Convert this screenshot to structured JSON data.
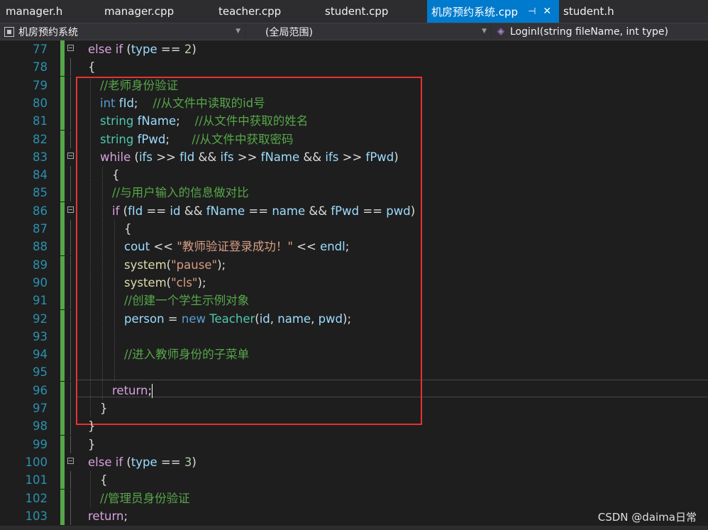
{
  "tabs": [
    {
      "label": "manager.h",
      "active": false
    },
    {
      "label": "manager.cpp",
      "active": false
    },
    {
      "label": "teacher.cpp",
      "active": false
    },
    {
      "label": "student.cpp",
      "active": false
    },
    {
      "label": "机房预约系统.cpp",
      "active": true,
      "pin": "⊣",
      "close": "✕"
    },
    {
      "label": "student.h",
      "active": false
    }
  ],
  "nav": {
    "project": "机房预约系统",
    "scope": "(全局范围)",
    "member": "LoginI(string fileName, int type)"
  },
  "lines": [
    {
      "n": "77",
      "tokens": [
        [
          "kw",
          "else if"
        ],
        [
          "pl",
          " ("
        ],
        [
          "var",
          "type"
        ],
        [
          "pl",
          " == "
        ],
        [
          "num",
          "2"
        ],
        [
          "pl",
          ")"
        ]
      ]
    },
    {
      "n": "78",
      "tokens": [
        [
          "pl",
          "{"
        ]
      ]
    },
    {
      "n": "79",
      "tokens": [
        [
          "com",
          "//老师身份验证"
        ]
      ]
    },
    {
      "n": "80",
      "tokens": [
        [
          "ty",
          "int"
        ],
        [
          "pl",
          " "
        ],
        [
          "var",
          "fId"
        ],
        [
          "pl",
          ";    "
        ],
        [
          "com",
          "//从文件中读取的id号"
        ]
      ]
    },
    {
      "n": "81",
      "tokens": [
        [
          "cls",
          "string"
        ],
        [
          "pl",
          " "
        ],
        [
          "var",
          "fName"
        ],
        [
          "pl",
          ";    "
        ],
        [
          "com",
          "//从文件中获取的姓名"
        ]
      ]
    },
    {
      "n": "82",
      "tokens": [
        [
          "cls",
          "string"
        ],
        [
          "pl",
          " "
        ],
        [
          "var",
          "fPwd"
        ],
        [
          "pl",
          ";      "
        ],
        [
          "com",
          "//从文件中获取密码"
        ]
      ]
    },
    {
      "n": "83",
      "tokens": [
        [
          "kw",
          "while"
        ],
        [
          "pl",
          " ("
        ],
        [
          "var",
          "ifs"
        ],
        [
          "pl",
          " >> "
        ],
        [
          "var",
          "fId"
        ],
        [
          "pl",
          " && "
        ],
        [
          "var",
          "ifs"
        ],
        [
          "pl",
          " >> "
        ],
        [
          "var",
          "fName"
        ],
        [
          "pl",
          " && "
        ],
        [
          "var",
          "ifs"
        ],
        [
          "pl",
          " >> "
        ],
        [
          "var",
          "fPwd"
        ],
        [
          "pl",
          ")"
        ]
      ]
    },
    {
      "n": "84",
      "tokens": [
        [
          "pl",
          "{"
        ]
      ]
    },
    {
      "n": "85",
      "tokens": [
        [
          "com",
          "//与用户输入的信息做对比"
        ]
      ]
    },
    {
      "n": "86",
      "tokens": [
        [
          "kw",
          "if"
        ],
        [
          "pl",
          " ("
        ],
        [
          "var",
          "fId"
        ],
        [
          "pl",
          " == "
        ],
        [
          "var",
          "id"
        ],
        [
          "pl",
          " && "
        ],
        [
          "var",
          "fName"
        ],
        [
          "pl",
          " == "
        ],
        [
          "var",
          "name"
        ],
        [
          "pl",
          " && "
        ],
        [
          "var",
          "fPwd"
        ],
        [
          "pl",
          " == "
        ],
        [
          "var",
          "pwd"
        ],
        [
          "pl",
          ")"
        ]
      ]
    },
    {
      "n": "87",
      "tokens": [
        [
          "pl",
          "{"
        ]
      ]
    },
    {
      "n": "88",
      "tokens": [
        [
          "var",
          "cout"
        ],
        [
          "pl",
          " << "
        ],
        [
          "str",
          "\"教师验证登录成功！\""
        ],
        [
          "pl",
          " << "
        ],
        [
          "var",
          "endl"
        ],
        [
          "pl",
          ";"
        ]
      ]
    },
    {
      "n": "89",
      "tokens": [
        [
          "fn",
          "system"
        ],
        [
          "pl",
          "("
        ],
        [
          "str",
          "\"pause\""
        ],
        [
          "pl",
          ");"
        ]
      ]
    },
    {
      "n": "90",
      "tokens": [
        [
          "fn",
          "system"
        ],
        [
          "pl",
          "("
        ],
        [
          "str",
          "\"cls\""
        ],
        [
          "pl",
          ");"
        ]
      ]
    },
    {
      "n": "91",
      "tokens": [
        [
          "com",
          "//创建一个学生示例对象"
        ]
      ]
    },
    {
      "n": "92",
      "tokens": [
        [
          "var",
          "person"
        ],
        [
          "pl",
          " = "
        ],
        [
          "ty",
          "new"
        ],
        [
          "pl",
          " "
        ],
        [
          "cls",
          "Teacher"
        ],
        [
          "pl",
          "("
        ],
        [
          "var",
          "id"
        ],
        [
          "pl",
          ", "
        ],
        [
          "var",
          "name"
        ],
        [
          "pl",
          ", "
        ],
        [
          "var",
          "pwd"
        ],
        [
          "pl",
          ");"
        ]
      ]
    },
    {
      "n": "93",
      "tokens": []
    },
    {
      "n": "94",
      "tokens": [
        [
          "com",
          "//进入教师身份的子菜单"
        ]
      ]
    },
    {
      "n": "95",
      "tokens": []
    },
    {
      "n": "96",
      "tokens": [
        [
          "kw",
          "return"
        ],
        [
          "pl",
          ";"
        ]
      ]
    },
    {
      "n": "97",
      "tokens": [
        [
          "pl",
          "}"
        ]
      ]
    },
    {
      "n": "98",
      "tokens": [
        [
          "pl",
          "}"
        ]
      ]
    },
    {
      "n": "99",
      "tokens": [
        [
          "pl",
          "}"
        ]
      ]
    },
    {
      "n": "100",
      "tokens": [
        [
          "kw",
          "else if"
        ],
        [
          "pl",
          " ("
        ],
        [
          "var",
          "type"
        ],
        [
          "pl",
          " == "
        ],
        [
          "num",
          "3"
        ],
        [
          "pl",
          ")"
        ]
      ]
    },
    {
      "n": "101",
      "tokens": [
        [
          "pl",
          "{"
        ]
      ]
    },
    {
      "n": "102",
      "tokens": [
        [
          "com",
          "//管理员身份验证"
        ]
      ]
    },
    {
      "n": "103",
      "tokens": [
        [
          "kw",
          "return"
        ],
        [
          "pl",
          ";"
        ]
      ]
    }
  ],
  "watermark": "CSDN @daima日常",
  "colors": {
    "accent": "#007acc",
    "highlight_box": "#e8322f",
    "line_number": "#2b91af",
    "comment": "#57a64a"
  }
}
